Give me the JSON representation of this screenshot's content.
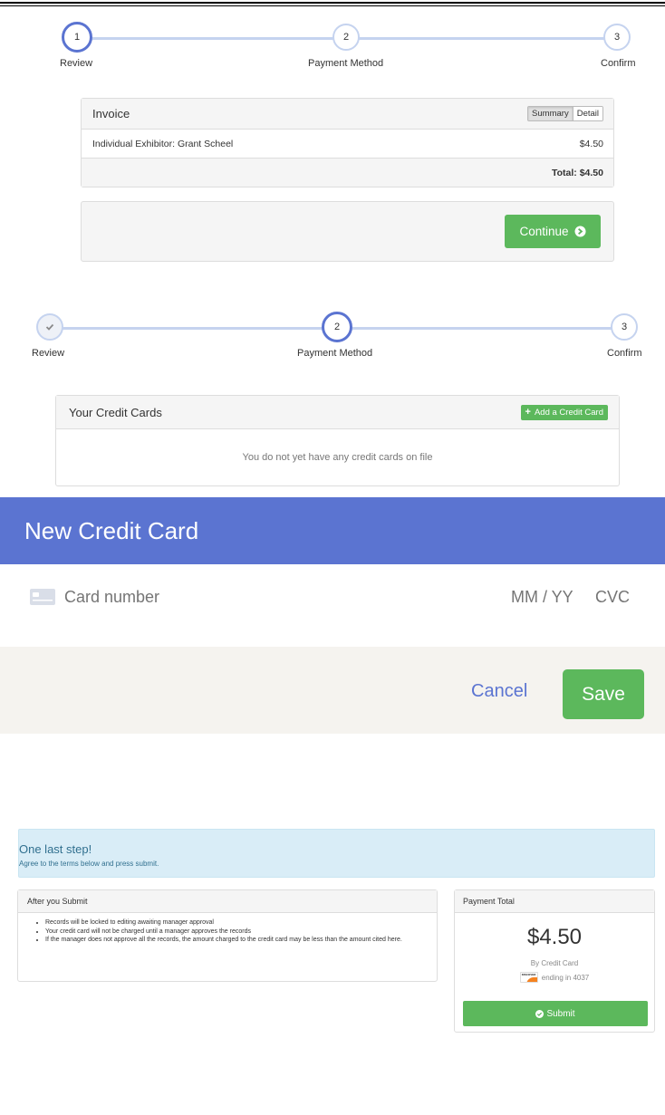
{
  "stepper1": {
    "steps": [
      {
        "num": "1",
        "label": "Review"
      },
      {
        "num": "2",
        "label": "Payment Method"
      },
      {
        "num": "3",
        "label": "Confirm"
      }
    ]
  },
  "invoice": {
    "title": "Invoice",
    "toggle": {
      "summary": "Summary",
      "detail": "Detail"
    },
    "item_name": "Individual Exhibitor: Grant Scheel",
    "item_amount": "$4.50",
    "total": "Total: $4.50",
    "continue_label": "Continue"
  },
  "stepper2": {
    "steps": [
      {
        "num": "✓",
        "label": "Review"
      },
      {
        "num": "2",
        "label": "Payment Method"
      },
      {
        "num": "3",
        "label": "Confirm"
      }
    ]
  },
  "cards": {
    "title": "Your Credit Cards",
    "add_label": "Add a Credit Card",
    "empty_text": "You do not yet have any credit cards on file"
  },
  "new_card": {
    "title": "New Credit Card",
    "card_number_placeholder": "Card number",
    "expiry_placeholder": "MM / YY",
    "cvc_placeholder": "CVC",
    "cancel_label": "Cancel",
    "save_label": "Save"
  },
  "confirm": {
    "alert_title": "One last step!",
    "alert_text": "Agree to the terms below and press submit.",
    "after_title": "After you Submit",
    "after_items": [
      "Records will be locked to editing awaiting manager approval",
      "Your credit card will not be charged until a manager approves the records",
      "If the manager does not approve all the records, the amount charged to the credit card may be less than the amount cited here."
    ],
    "payment_title": "Payment Total",
    "amount": "$4.50",
    "method": "By Credit Card",
    "card_brand": "DISCOVER",
    "card_ending": "ending in 4037",
    "submit_label": "Submit"
  },
  "colors": {
    "primary": "#5b74d1",
    "success": "#5cb85c",
    "info_bg": "#d9edf7"
  }
}
